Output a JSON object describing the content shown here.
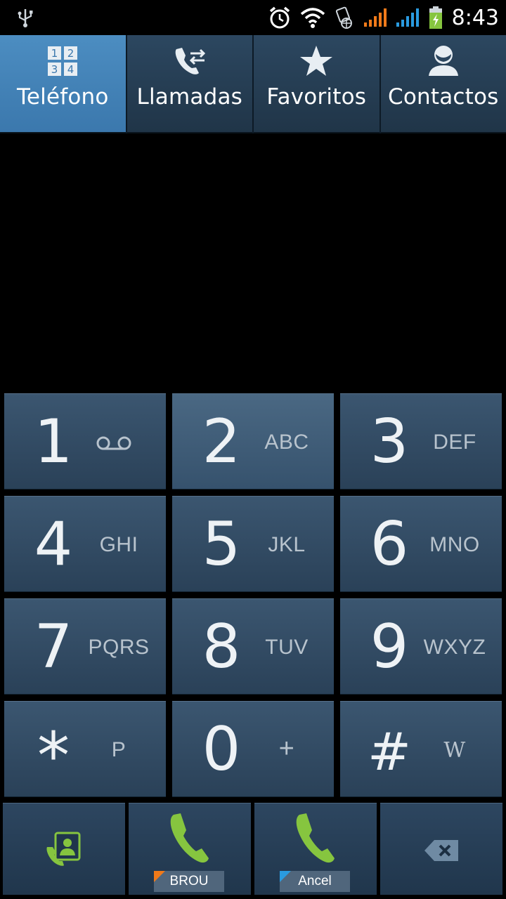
{
  "status_bar": {
    "time": "8:43",
    "icons": [
      "usb-icon",
      "alarm-icon",
      "wifi-icon",
      "sim-icon",
      "signal-1-icon",
      "signal-2-icon",
      "battery-charging-icon"
    ],
    "colors": {
      "signal_1": "#f07a1a",
      "signal_2": "#2a9be0",
      "battery": "#86c53f"
    }
  },
  "tabs": [
    {
      "label": "Teléfono",
      "icon": "dialpad-icon",
      "active": true
    },
    {
      "label": "Llamadas",
      "icon": "call-log-icon",
      "active": false
    },
    {
      "label": "Favoritos",
      "icon": "star-icon",
      "active": false
    },
    {
      "label": "Contactos",
      "icon": "contact-icon",
      "active": false
    }
  ],
  "keypad": [
    {
      "digit": "1",
      "letters": "",
      "icon": "voicemail-icon"
    },
    {
      "digit": "2",
      "letters": "ABC"
    },
    {
      "digit": "3",
      "letters": "DEF"
    },
    {
      "digit": "4",
      "letters": "GHI"
    },
    {
      "digit": "5",
      "letters": "JKL"
    },
    {
      "digit": "6",
      "letters": "MNO"
    },
    {
      "digit": "7",
      "letters": "PQRS"
    },
    {
      "digit": "8",
      "letters": "TUV"
    },
    {
      "digit": "9",
      "letters": "WXYZ"
    },
    {
      "digit": "*",
      "letters": "P"
    },
    {
      "digit": "0",
      "letters": "+"
    },
    {
      "digit": "#",
      "letters": "W"
    }
  ],
  "bottom_bar": {
    "contacts_icon": "add-contact-icon",
    "call_sim1": {
      "label": "BROU",
      "icon": "phone-call-icon",
      "flag_color": "#f07a1a"
    },
    "call_sim2": {
      "label": "Ancel",
      "icon": "phone-call-icon",
      "flag_color": "#2a9be0"
    },
    "delete_icon": "backspace-icon",
    "accent": "#86c53f"
  }
}
